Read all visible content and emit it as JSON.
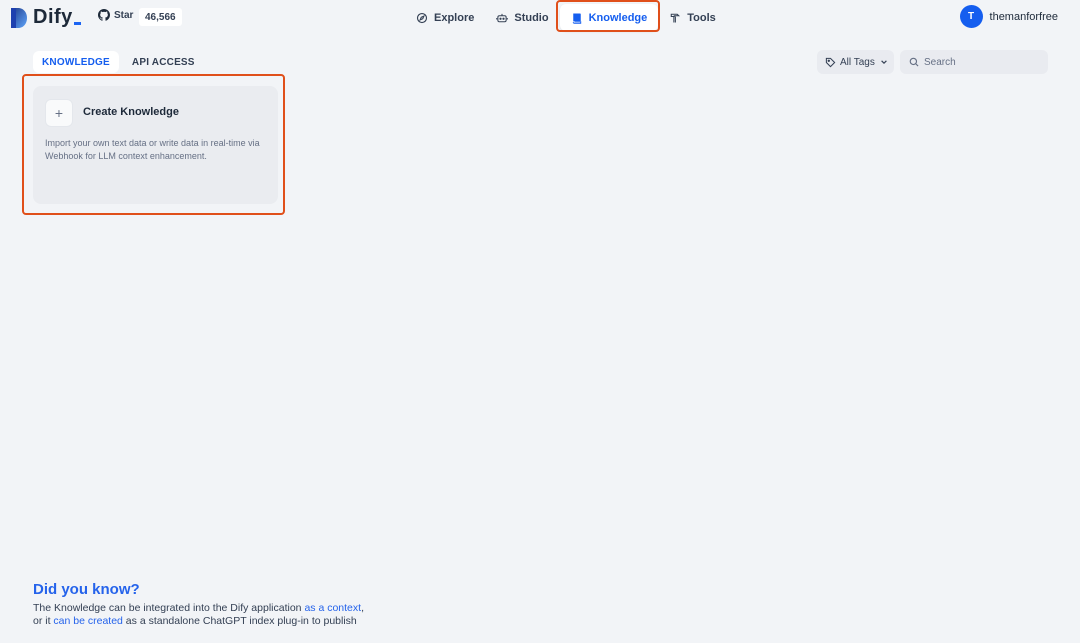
{
  "brand": {
    "name": "Dify"
  },
  "github": {
    "label": "Star",
    "count": "46,566"
  },
  "nav": {
    "explore": "Explore",
    "studio": "Studio",
    "knowledge": "Knowledge",
    "tools": "Tools"
  },
  "user": {
    "initial": "T",
    "name": "themanforfree"
  },
  "tabs": {
    "knowledge": "KNOWLEDGE",
    "api_access": "API ACCESS"
  },
  "filters": {
    "tags_label": "All Tags",
    "search_placeholder": "Search"
  },
  "create_card": {
    "title": "Create Knowledge",
    "description": "Import your own text data or write data in real-time via Webhook for LLM context enhancement."
  },
  "tip": {
    "title": "Did you know?",
    "line1_prefix": "The Knowledge can be integrated into the Dify application ",
    "line1_link": "as a context",
    "line1_suffix": ",",
    "line2_prefix": "or it ",
    "line2_link": "can be created",
    "line2_suffix": " as a standalone ChatGPT index plug-in to publish"
  },
  "colors": {
    "accent": "#155eef",
    "highlight": "#e04f1a",
    "background": "#f2f4f7"
  }
}
